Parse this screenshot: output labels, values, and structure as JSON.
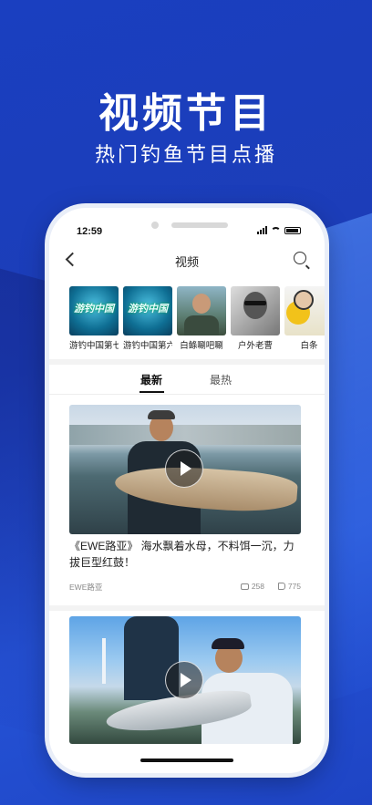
{
  "promo": {
    "title": "视频节目",
    "subtitle": "热门钓鱼节目点播"
  },
  "status_bar": {
    "time": "12:59"
  },
  "nav": {
    "title": "视频",
    "back_icon": "chevron-left-icon",
    "search_icon": "search-icon"
  },
  "channels": [
    {
      "label": "游钓中国第七",
      "thumb_text": "游钓中国"
    },
    {
      "label": "游钓中国第六",
      "thumb_text": "游钓中国"
    },
    {
      "label": "白鲦唰吧唰",
      "thumb_text": ""
    },
    {
      "label": "户外老曹",
      "thumb_text": ""
    },
    {
      "label": "白条",
      "thumb_text": ""
    }
  ],
  "tabs": [
    {
      "label": "最新",
      "active": true
    },
    {
      "label": "最热",
      "active": false
    }
  ],
  "videos": [
    {
      "title": "《EWE路亚》 海水飘着水母，不料饵一沉，力拔巨型红鼓！",
      "author": "EWE路亚",
      "comments": "258",
      "likes": "775"
    },
    {
      "title": "",
      "author": "",
      "comments": "",
      "likes": ""
    }
  ],
  "colors": {
    "background": "#1c3db8",
    "accent": "#ffffff"
  }
}
